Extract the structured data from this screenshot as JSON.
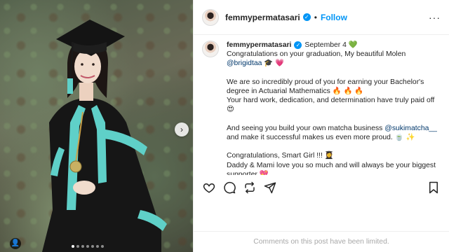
{
  "post": {
    "username": "femmypermatasari",
    "header_separator": "•",
    "follow_label": "Follow",
    "more_label": "···",
    "verified_glyph": "✓",
    "date": "September 4",
    "green_heart": "💚",
    "caption_lines": [
      {
        "parts": [
          {
            "t": "Congratulations on your graduation, My beautiful Molen"
          }
        ]
      },
      {
        "parts": [
          {
            "t": "@brigidtaa",
            "mention": true
          },
          {
            "t": " 🎓 💗"
          }
        ]
      },
      {
        "blank": true
      },
      {
        "parts": [
          {
            "t": "We are so incredibly proud of you for earning your Bachelor's"
          }
        ]
      },
      {
        "parts": [
          {
            "t": "degree in Actuarial Mathematics 🔥 🔥 🔥"
          }
        ]
      },
      {
        "parts": [
          {
            "t": "Your hard work, dedication, and determination have truly paid off"
          }
        ]
      },
      {
        "parts": [
          {
            "t": "😍"
          }
        ]
      },
      {
        "blank": true
      },
      {
        "parts": [
          {
            "t": "And seeing you build your own matcha business "
          },
          {
            "t": "@sukimatcha__",
            "mention": true
          }
        ]
      },
      {
        "parts": [
          {
            "t": "and make it successful makes us even more proud. 🍵 ✨"
          }
        ]
      },
      {
        "blank": true
      },
      {
        "parts": [
          {
            "t": "Congratulations, Smart Girl !!! 👩‍🎓"
          }
        ]
      },
      {
        "parts": [
          {
            "t": "Daddy & Mami love you so much and will always be your biggest"
          }
        ]
      },
      {
        "parts": [
          {
            "t": "supporter 💖"
          }
        ]
      }
    ],
    "comments_disabled_note": "Comments on this post have been limited."
  },
  "carousel": {
    "next_icon": "chevron-right-icon",
    "next_glyph": "›",
    "dot_count": 7,
    "active_dot": 0
  },
  "photo_user_tag_glyph": "👤",
  "colors": {
    "accent": "#0095f6",
    "gown": "#1a1a1a",
    "gown_trim": "#5fd0c8",
    "mention": "#00376b"
  }
}
